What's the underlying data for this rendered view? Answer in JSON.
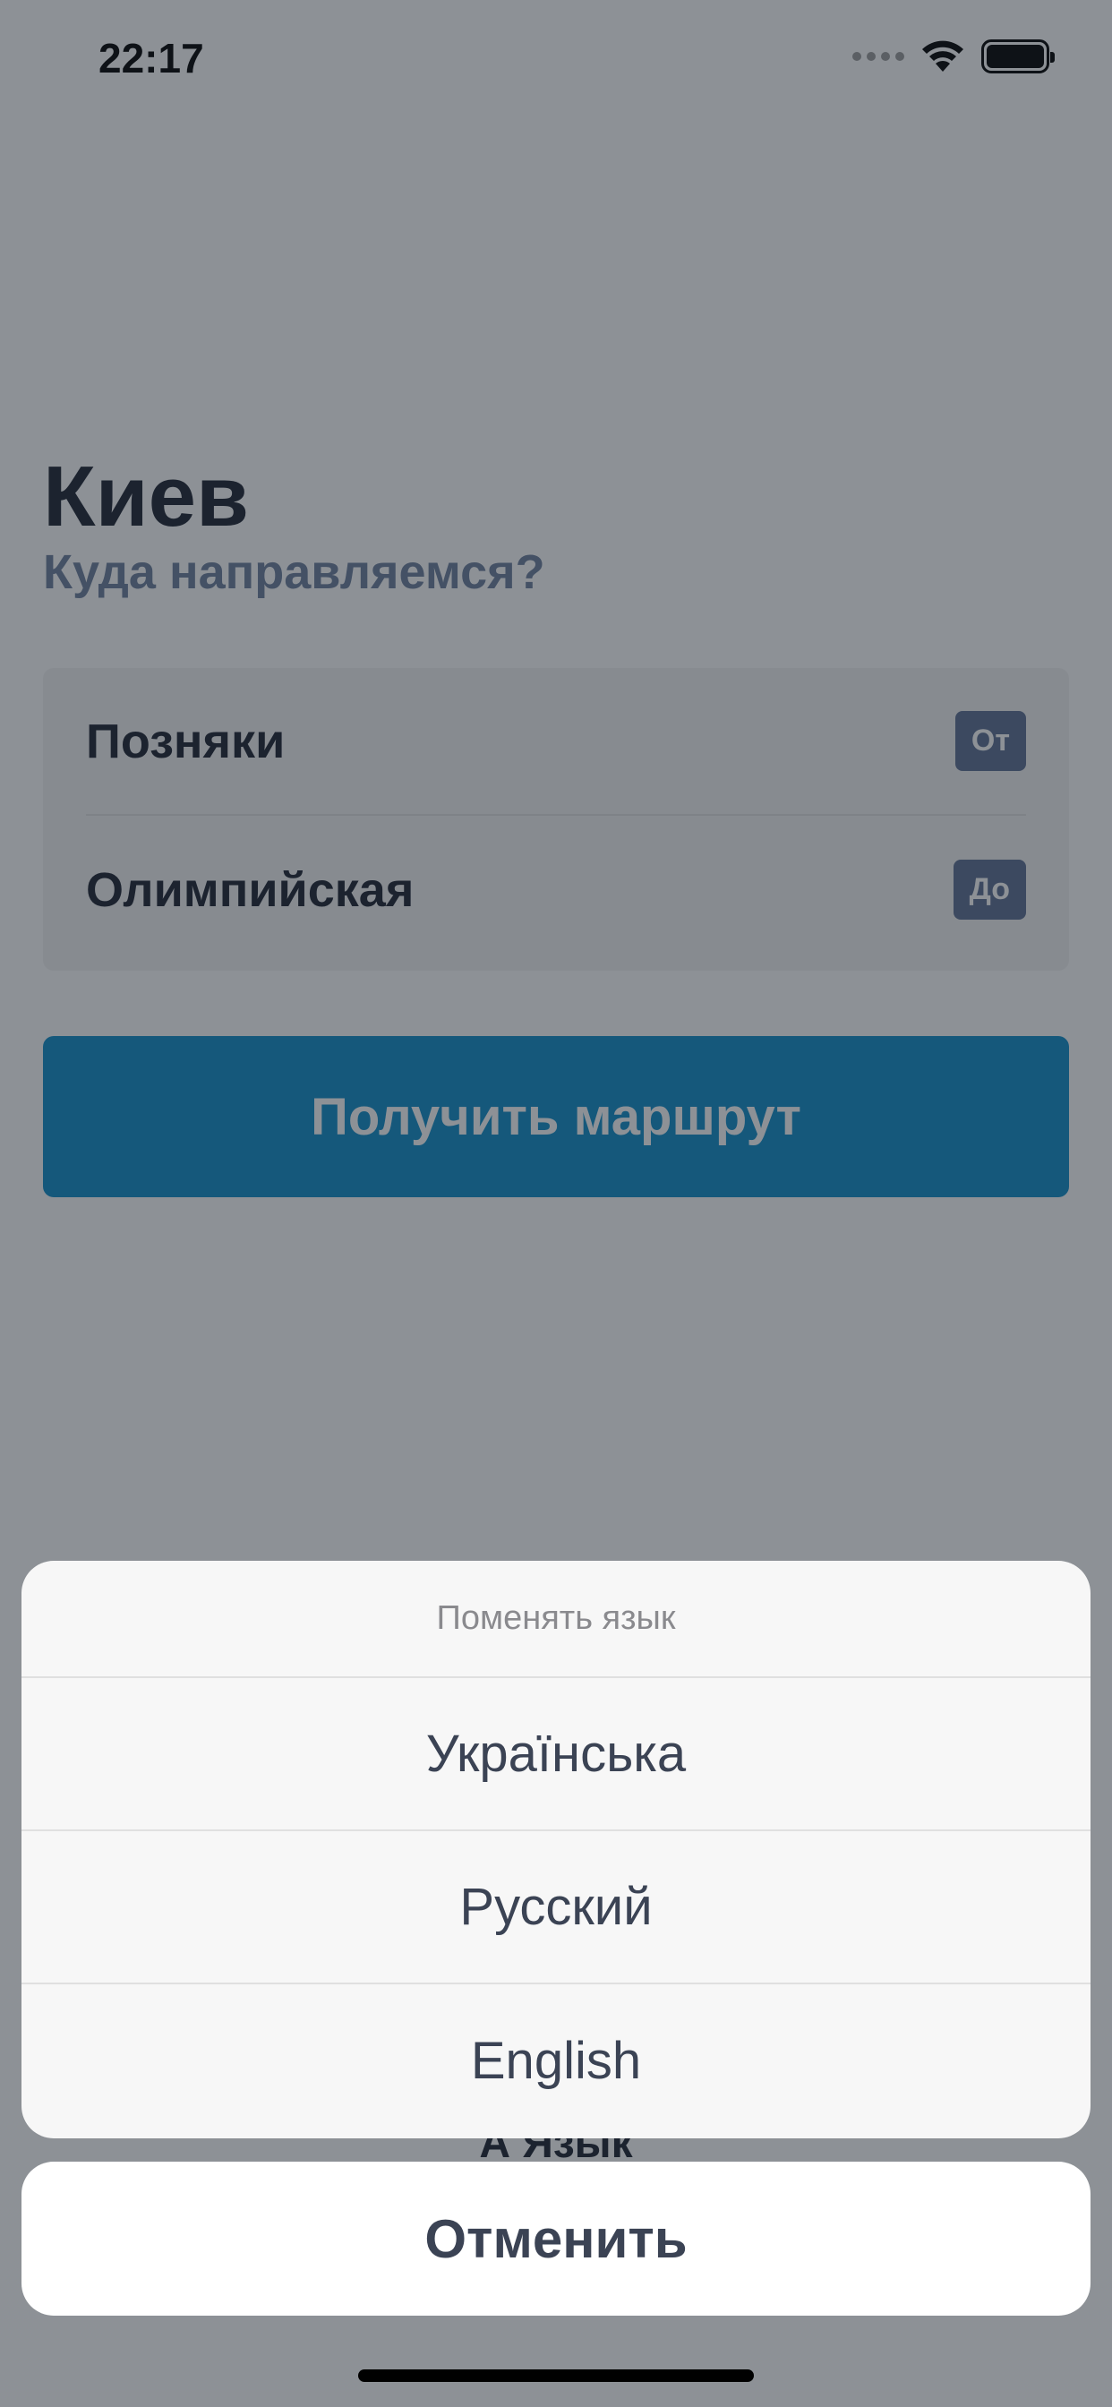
{
  "status_bar": {
    "time": "22:17"
  },
  "main": {
    "city": "Киев",
    "subtitle": "Куда направляемся?",
    "from": {
      "name": "Позняки",
      "tag": "От"
    },
    "to": {
      "name": "Олимпийская",
      "tag": "До"
    },
    "get_route_label": "Получить маршрут",
    "language_label": "Aͯ Язык"
  },
  "action_sheet": {
    "title": "Поменять язык",
    "options": [
      "Українська",
      "Русский",
      "English"
    ],
    "cancel_label": "Отменить"
  },
  "colors": {
    "primary_button": "#0f8dc9",
    "tag_background": "#5c6f92",
    "text_dark": "#1c2230",
    "subtitle": "#6d7f9c"
  }
}
